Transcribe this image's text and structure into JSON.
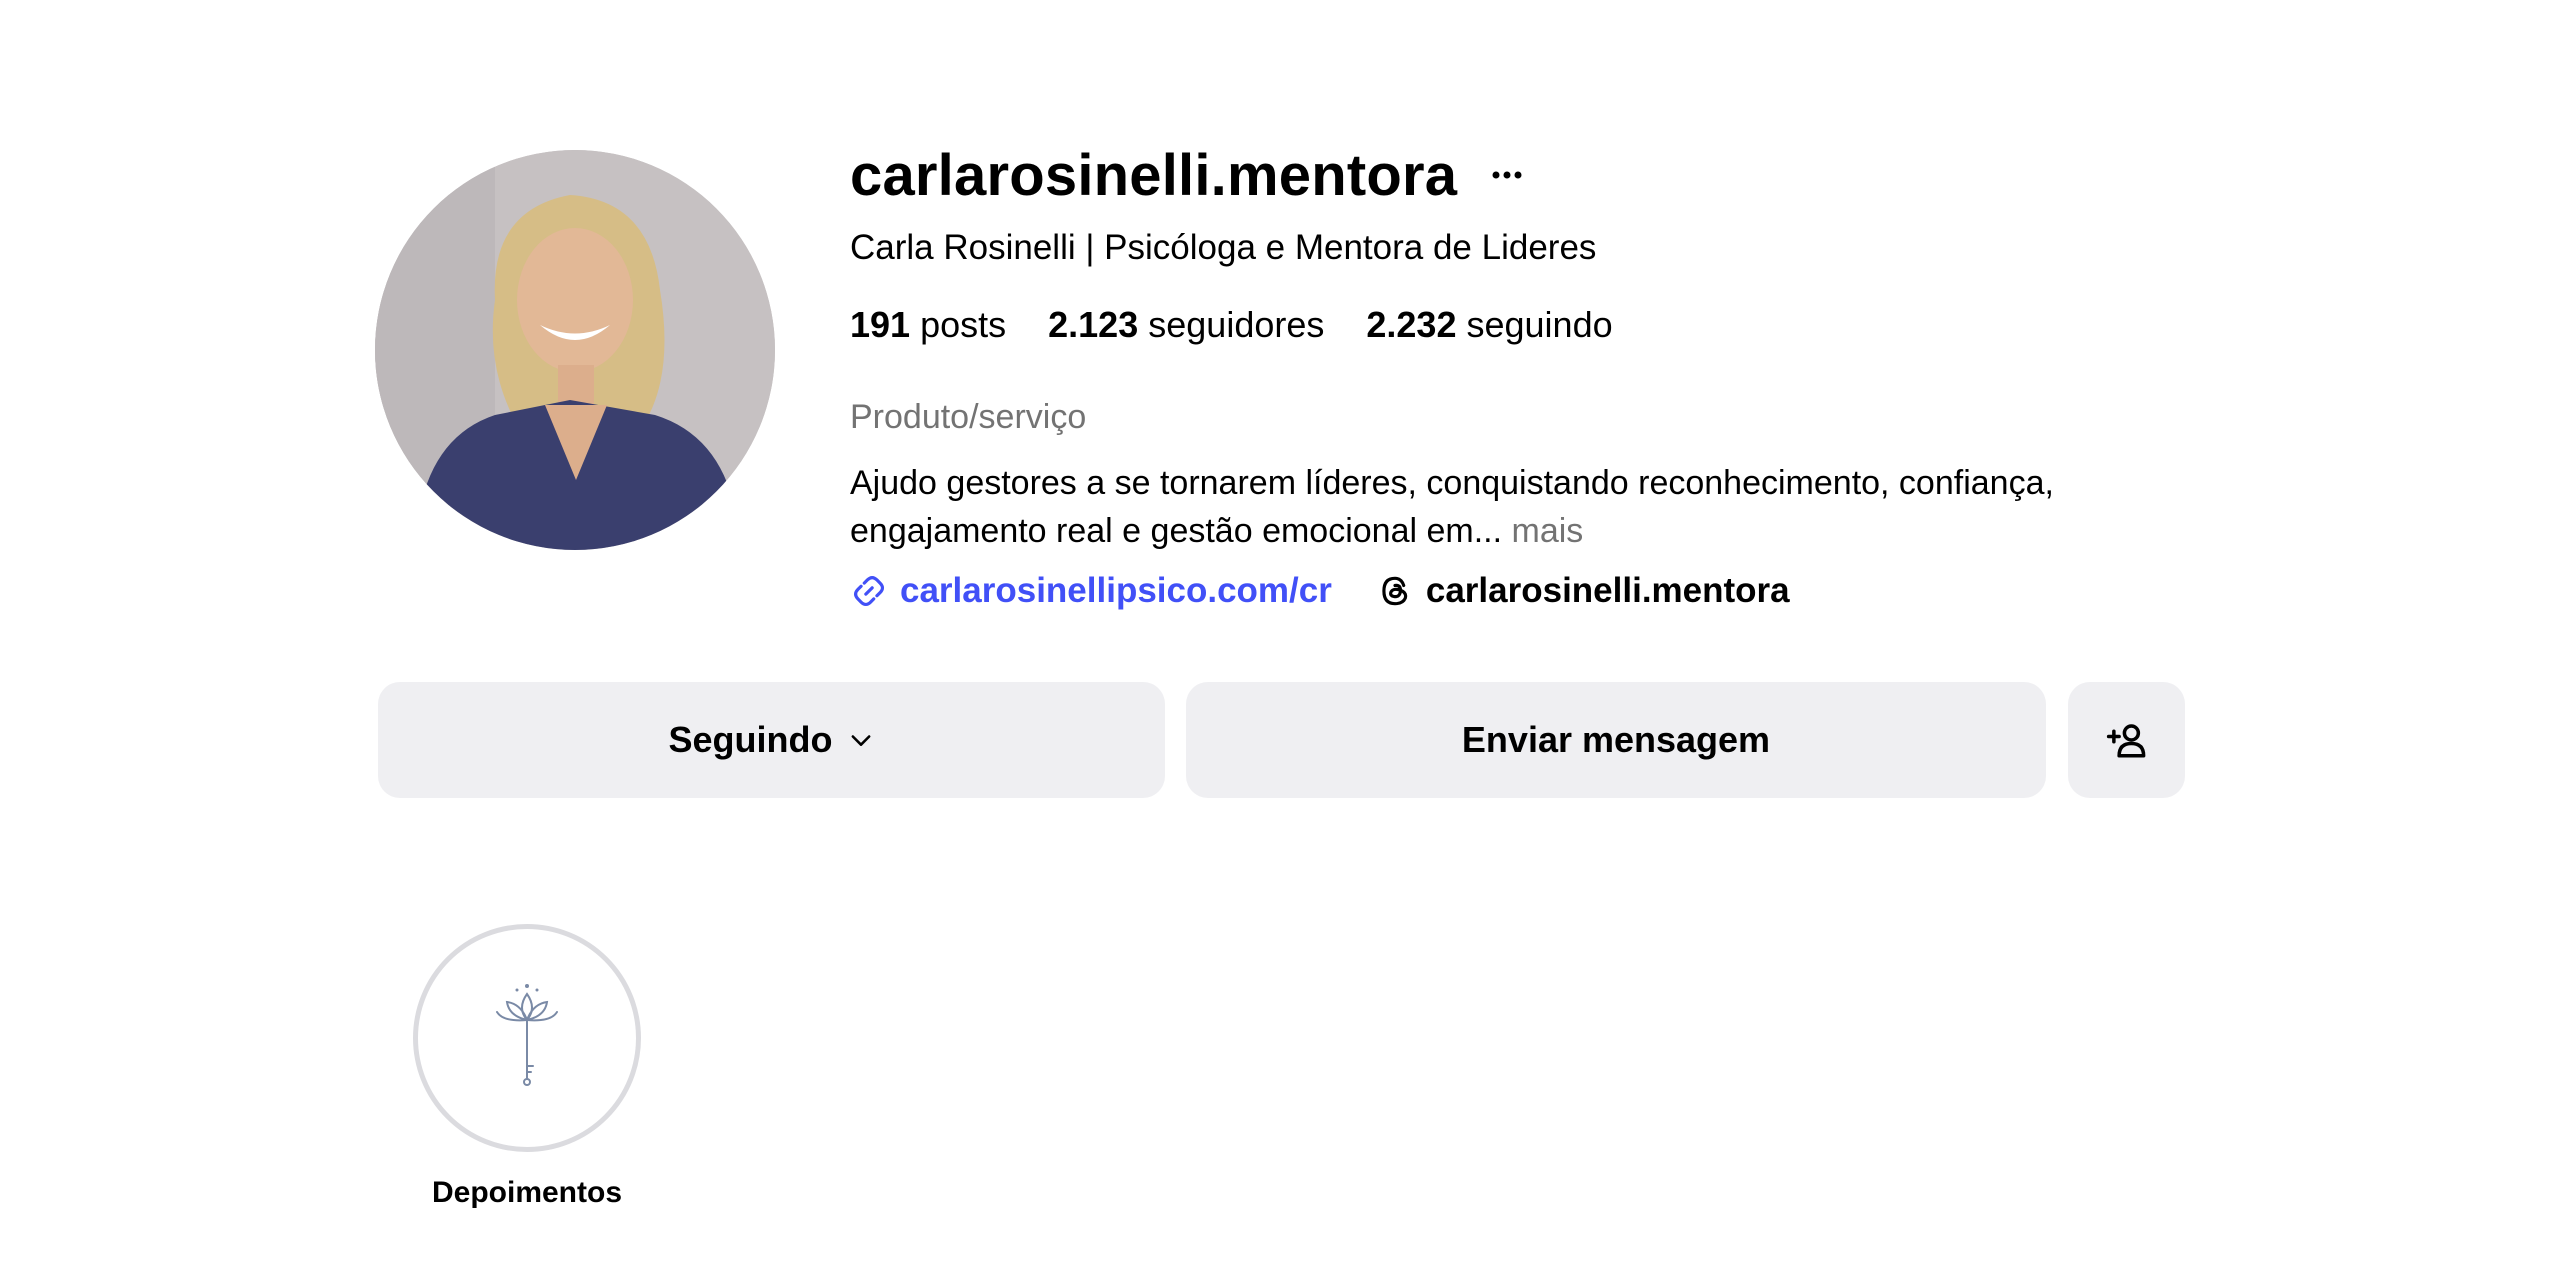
{
  "profile": {
    "username": "carlarosinelli.mentora",
    "full_name": "Carla Rosinelli | Psicóloga e Mentora de Lideres",
    "stats": {
      "posts_count": "191",
      "posts_label": "posts",
      "followers_count": "2.123",
      "followers_label": "seguidores",
      "following_count": "2.232",
      "following_label": "seguindo"
    },
    "category": "Produto/serviço",
    "bio": "Ajudo gestores a se tornarem líderes, conquistando reconhecimento, confiança, engajamento real e gestão emocional em...",
    "bio_more": "mais",
    "link_url": "carlarosinellipsico.com/cr",
    "threads_handle": "carlarosinelli.mentora"
  },
  "actions": {
    "following_label": "Seguindo",
    "message_label": "Enviar mensagem"
  },
  "highlights": [
    {
      "label": "Depoimentos",
      "icon": "lotus-key-icon"
    }
  ],
  "icons": {
    "more": "more-icon",
    "link": "link-icon",
    "threads": "threads-icon",
    "chevron": "chevron-down-icon",
    "add_user": "add-user-icon"
  },
  "colors": {
    "link": "#4150f7",
    "secondary_text": "#737373",
    "button_bg": "#efeff2",
    "highlight_ring": "#dbdbdf"
  }
}
